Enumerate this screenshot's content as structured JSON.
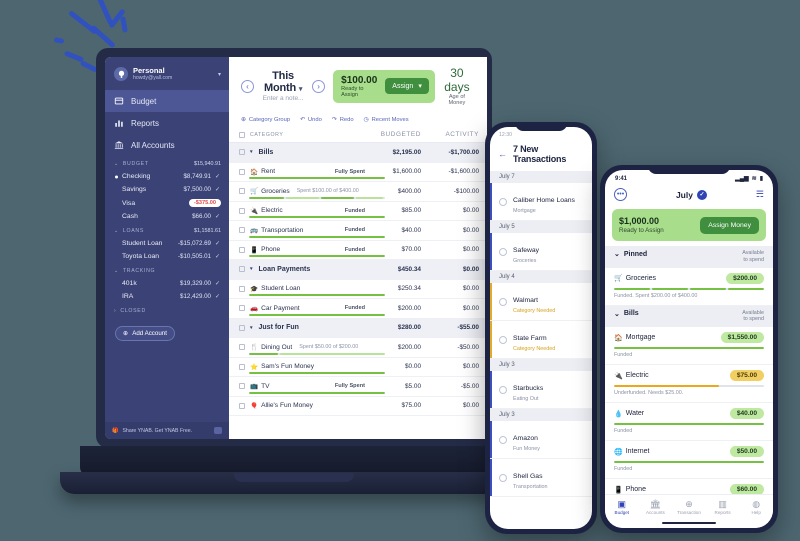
{
  "theme": {
    "background": "#4d6670",
    "sidebar_bg": "#3b4376",
    "device_bezel": "#1d2342",
    "green_light": "#a8dd8b",
    "green_dark": "#3f8f3f",
    "amber": "#e9a81e",
    "negative_red": "#e04a4a",
    "link_blue": "#5865b8"
  },
  "laptop": {
    "sidebar": {
      "account": {
        "logo_icon": "ynab-logo-icon",
        "name": "Personal",
        "email": "howdy@yall.com",
        "caret_icon": "chevron-down-icon"
      },
      "nav": [
        {
          "label": "Budget",
          "icon": "budget-icon",
          "active": true
        },
        {
          "label": "Reports",
          "icon": "reports-bar-chart-icon",
          "active": false
        },
        {
          "label": "All Accounts",
          "icon": "bank-icon",
          "active": false
        }
      ],
      "groups": [
        {
          "label": "BUDGET",
          "total": "$15,940.91",
          "chevron": "chevron-down-icon",
          "accounts": [
            {
              "name": "Checking",
              "amount": "$8,749.91",
              "check": "✓",
              "selected": true,
              "negative": false
            },
            {
              "name": "Savings",
              "amount": "$7,500.00",
              "check": "✓",
              "selected": false,
              "negative": false
            },
            {
              "name": "Visa",
              "amount": "-$375.00",
              "check": "",
              "selected": false,
              "negative": true
            },
            {
              "name": "Cash",
              "amount": "$66.00",
              "check": "✓",
              "selected": false,
              "negative": false
            }
          ]
        },
        {
          "label": "LOANS",
          "total": "$1,1581.61",
          "chevron": "chevron-down-icon",
          "accounts": [
            {
              "name": "Student Loan",
              "amount": "-$15,072.69",
              "check": "✓",
              "selected": false,
              "negative": false
            },
            {
              "name": "Toyota Loan",
              "amount": "-$10,505.01",
              "check": "✓",
              "selected": false,
              "negative": false
            }
          ]
        },
        {
          "label": "TRACKING",
          "total": "",
          "chevron": "chevron-down-icon",
          "accounts": [
            {
              "name": "401k",
              "amount": "$19,329.00",
              "check": "✓",
              "selected": false,
              "negative": false
            },
            {
              "name": "IRA",
              "amount": "$12,429.00",
              "check": "✓",
              "selected": false,
              "negative": false
            }
          ]
        },
        {
          "label": "CLOSED",
          "total": "",
          "chevron": "chevron-right-icon",
          "accounts": []
        }
      ],
      "add_account_label": "Add Account",
      "add_account_icon": "plus-circle-icon",
      "share_label": "Share YNAB. Get YNAB Free.",
      "share_icon": "gift-icon",
      "collapse_icon": "collapse-panel-icon"
    },
    "header": {
      "prev_icon": "chevron-left-circle-icon",
      "next_icon": "chevron-right-circle-icon",
      "month": "This Month",
      "month_caret": "chevron-down-icon",
      "note_placeholder": "Enter a note...",
      "ready_to_assign_amount": "$100.00",
      "ready_to_assign_label": "Ready to Assign",
      "assign_label": "Assign",
      "assign_caret": "chevron-down-icon",
      "age_of_money_value": "30 days",
      "age_of_money_label": "Age of Money"
    },
    "toolbar": [
      {
        "label": "Category Group",
        "icon": "plus-circle-icon"
      },
      {
        "label": "Undo",
        "icon": "undo-arrow-icon"
      },
      {
        "label": "Redo",
        "icon": "redo-arrow-icon"
      },
      {
        "label": "Recent Moves",
        "icon": "clock-icon"
      }
    ],
    "table": {
      "columns": [
        "CATEGORY",
        "BUDGETED",
        "ACTIVITY"
      ],
      "rows": [
        {
          "type": "group",
          "name": "Bills",
          "note": "",
          "budgeted": "$2,195.00",
          "activity": "-$1,700.00",
          "emoji": "",
          "progress": []
        },
        {
          "type": "item",
          "name": "Rent",
          "emoji": "🏠",
          "note": "Fully Spent",
          "note_style": "right",
          "budgeted": "$1,600.00",
          "activity": "-$1,600.00",
          "progress": [
            100
          ]
        },
        {
          "type": "item",
          "name": "Groceries",
          "emoji": "🛒",
          "note": "Spent $100.00 of $400.00",
          "note_style": "inline",
          "budgeted": "$400.00",
          "activity": "-$100.00",
          "progress": [
            26,
            24,
            24,
            20
          ]
        },
        {
          "type": "item",
          "name": "Electric",
          "emoji": "🔌",
          "note": "Funded",
          "note_style": "right",
          "budgeted": "$85.00",
          "activity": "$0.00",
          "progress": [
            100
          ]
        },
        {
          "type": "item",
          "name": "Transportation",
          "emoji": "🚌",
          "note": "Funded",
          "note_style": "right",
          "budgeted": "$40.00",
          "activity": "$0.00",
          "progress": [
            100
          ]
        },
        {
          "type": "item",
          "name": "Phone",
          "emoji": "📱",
          "note": "Funded",
          "note_style": "right",
          "budgeted": "$70.00",
          "activity": "$0.00",
          "progress": [
            100
          ]
        },
        {
          "type": "group",
          "name": "Loan Payments",
          "note": "",
          "budgeted": "$450.34",
          "activity": "$0.00",
          "emoji": "",
          "progress": []
        },
        {
          "type": "item",
          "name": "Student Loan",
          "emoji": "🎓",
          "note": "",
          "note_style": "right",
          "budgeted": "$250.34",
          "activity": "$0.00",
          "progress": [
            100
          ]
        },
        {
          "type": "item",
          "name": "Car Payment",
          "emoji": "🚗",
          "note": "Funded",
          "note_style": "right",
          "budgeted": "$200.00",
          "activity": "$0.00",
          "progress": [
            100
          ]
        },
        {
          "type": "group",
          "name": "Just for Fun",
          "note": "",
          "budgeted": "$280.00",
          "activity": "-$55.00",
          "emoji": "",
          "progress": []
        },
        {
          "type": "item",
          "name": "Dining Out",
          "emoji": "🍴",
          "note": "Spent $50.00 of $200.00",
          "note_style": "inline",
          "budgeted": "$200.00",
          "activity": "-$50.00",
          "progress": [
            22,
            78
          ]
        },
        {
          "type": "item",
          "name": "Sam's Fun Money",
          "emoji": "⭐",
          "note": "",
          "note_style": "right",
          "budgeted": "$0.00",
          "activity": "$0.00",
          "progress": [
            100
          ]
        },
        {
          "type": "item",
          "name": "TV",
          "emoji": "📺",
          "note": "Fully Spent",
          "note_style": "right",
          "budgeted": "$5.00",
          "activity": "-$5.00",
          "progress": [
            100
          ]
        },
        {
          "type": "item",
          "name": "Allie's Fun Money",
          "emoji": "🎈",
          "note": "",
          "note_style": "right",
          "budgeted": "$75.00",
          "activity": "$0.00",
          "progress": []
        }
      ]
    }
  },
  "phone_transactions": {
    "status_time": "12:30",
    "back_icon": "arrow-left-icon",
    "title": "7 New Transactions",
    "sections": [
      {
        "date": "July 7",
        "items": [
          {
            "payee": "Caliber Home Loans",
            "category": "Mortgage",
            "warn": false
          }
        ]
      },
      {
        "date": "July 5",
        "items": [
          {
            "payee": "Safeway",
            "category": "Groceries",
            "warn": false
          }
        ]
      },
      {
        "date": "July 4",
        "items": [
          {
            "payee": "Walmart",
            "category": "Category Needed",
            "warn": true
          },
          {
            "payee": "State Farm",
            "category": "Category Needed",
            "warn": true
          }
        ]
      },
      {
        "date": "July 3",
        "items": [
          {
            "payee": "Starbucks",
            "category": "Eating Out",
            "warn": false
          }
        ]
      },
      {
        "date": "July 3",
        "items": [
          {
            "payee": "Amazon",
            "category": "Fun Money",
            "warn": false
          },
          {
            "payee": "Shell Gas",
            "category": "Transportation",
            "warn": false
          }
        ]
      }
    ]
  },
  "phone_budget": {
    "status_time": "9:41",
    "status_icons": [
      "signal-icon",
      "wifi-icon",
      "battery-icon"
    ],
    "menu_icon": "more-dots-icon",
    "month": "July",
    "month_check_icon": "check-circle-icon",
    "edit_icon": "edit-list-icon",
    "ready_to_assign_amount": "$1,000.00",
    "ready_to_assign_label": "Ready to Assign",
    "assign_label": "Assign Money",
    "available_header": "Available\nto spend",
    "groups": [
      {
        "name": "Pinned",
        "chevron": "chevron-down-icon",
        "available_label_line1": "Available",
        "available_label_line2": "to spend",
        "rows": [
          {
            "name": "Groceries",
            "emoji": "🛒",
            "amount": "$200.00",
            "pill": "green",
            "bar": [
              25,
              25,
              25,
              25
            ],
            "bar_color": "green",
            "sub": "Funded. Spent $200.00 of $400.00"
          }
        ]
      },
      {
        "name": "Bills",
        "chevron": "chevron-down-icon",
        "available_label_line1": "Available",
        "available_label_line2": "to spend",
        "rows": [
          {
            "name": "Mortgage",
            "emoji": "🏠",
            "amount": "$1,550.00",
            "pill": "green",
            "bar": [
              100
            ],
            "bar_color": "green",
            "sub": "Funded"
          },
          {
            "name": "Electric",
            "emoji": "🔌",
            "amount": "$75.00",
            "pill": "amber",
            "bar": [
              70
            ],
            "bar_color": "amber",
            "sub": "Underfunded. Needs $25.00."
          },
          {
            "name": "Water",
            "emoji": "💧",
            "amount": "$40.00",
            "pill": "green",
            "bar": [
              100
            ],
            "bar_color": "green",
            "sub": "Funded"
          },
          {
            "name": "Internet",
            "emoji": "🌐",
            "amount": "$50.00",
            "pill": "green",
            "bar": [
              100
            ],
            "bar_color": "green",
            "sub": "Funded"
          },
          {
            "name": "Phone",
            "emoji": "📱",
            "amount": "$60.00",
            "pill": "green",
            "bar": [
              100
            ],
            "bar_color": "green",
            "sub": ""
          }
        ]
      }
    ],
    "nav": [
      {
        "label": "Budget",
        "icon": "budget-icon",
        "glyph": "▣",
        "active": true
      },
      {
        "label": "Accounts",
        "icon": "bank-icon",
        "glyph": "🏛",
        "active": false
      },
      {
        "label": "Transaction",
        "icon": "plus-circle-icon",
        "glyph": "⊕",
        "active": false
      },
      {
        "label": "Reports",
        "icon": "bar-chart-icon",
        "glyph": "▥",
        "active": false
      },
      {
        "label": "Help",
        "icon": "help-circle-icon",
        "glyph": "◍",
        "active": false
      }
    ]
  }
}
